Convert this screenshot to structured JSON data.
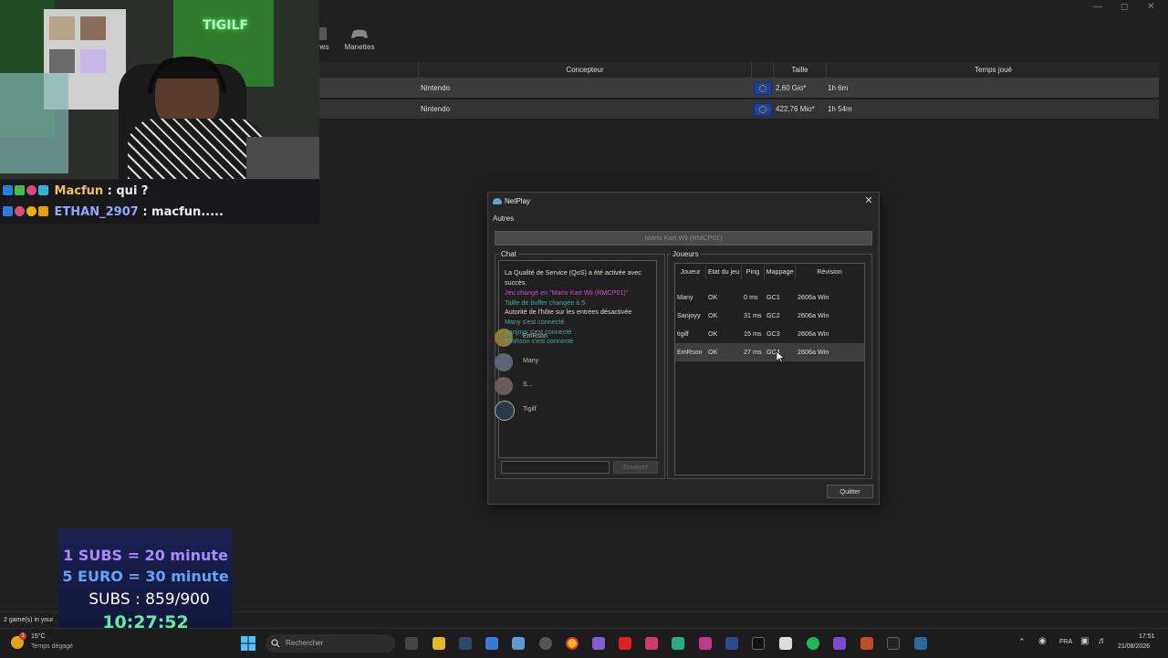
{
  "dolphin": {
    "toolbar": [
      {
        "label": "smes"
      },
      {
        "label": "Manettes"
      }
    ],
    "columns": [
      "Concepteur",
      "Taille",
      "Temps joué"
    ],
    "rows": [
      {
        "maker": "Nintendo",
        "size": "2,60 Gio*",
        "time": "1h 6m"
      },
      {
        "maker": "Nintendo",
        "size": "422,76 Mio*",
        "time": "1h 54m"
      }
    ],
    "status": "2 game(s) in your"
  },
  "stream_chat": [
    {
      "name": "Macfun",
      "text": ": qui ?"
    },
    {
      "name": "ETHAN_2907",
      "text": ": macfun....."
    }
  ],
  "netplay": {
    "title": "NetPlay",
    "menu": "Autres",
    "game": "Mario Kart Wii (RMCP01)",
    "chat_label": "Chat",
    "players_label": "Joueurs",
    "chat_lines": [
      {
        "text": "La Qualité de Service (QoS) a été activée avec",
        "color": "#dddddd"
      },
      {
        "text": "succès.",
        "color": "#dddddd"
      },
      {
        "text": "Jeu changé en \"Mario Kart Wii (RMCP01)\"",
        "color": "#d14bd1"
      },
      {
        "text": "Taille de buffer changée à 5",
        "color": "#4fa89a"
      },
      {
        "text": "Autorité de l'hôte sur les entrées désactivée",
        "color": "#dddddd"
      },
      {
        "text": "Many s'est connecté",
        "color": "#4fa89a"
      },
      {
        "text": "Sanjoyy s'est connecté",
        "color": "#4fa89a"
      },
      {
        "text": "EmRson s'est connecté",
        "color": "#4fa89a"
      }
    ],
    "avatars": [
      "EmRson",
      "Many",
      "S...",
      "Tigilf"
    ],
    "send_label": "Envoyer",
    "player_headers": [
      "Joueur",
      "Etat du jeu",
      "Ping",
      "Mappage",
      "Révision"
    ],
    "players": [
      {
        "name": "Many",
        "state": "OK",
        "ping": "0 ms",
        "map": "GC1",
        "rev": "2606a Win"
      },
      {
        "name": "Sanjoyy",
        "state": "OK",
        "ping": "31 ms",
        "map": "GC2",
        "rev": "2606a Win"
      },
      {
        "name": "tigilf",
        "state": "OK",
        "ping": "15 ms",
        "map": "GC3",
        "rev": "2606a Win"
      },
      {
        "name": "EmRson",
        "state": "OK",
        "ping": "27 ms",
        "map": "GC4",
        "rev": "2606a Win"
      }
    ],
    "quit_label": "Quitter"
  },
  "subs_overlay": {
    "line1": "1 SUBS = 20 minute",
    "line2": "5 EURO = 30 minute",
    "line3": "SUBS : 859/900",
    "timer": "10:27:52"
  },
  "taskbar": {
    "temp": "15°C",
    "weather": "Temps dégagé",
    "search": "Rechercher",
    "lang": "FRA",
    "time": "17:51",
    "date": "21/08/2026",
    "weather_badge": "1"
  },
  "colors": {
    "timer": "#5ff0a0",
    "subs_line1": "#a78bfa",
    "subs_line2": "#60a5fa"
  }
}
